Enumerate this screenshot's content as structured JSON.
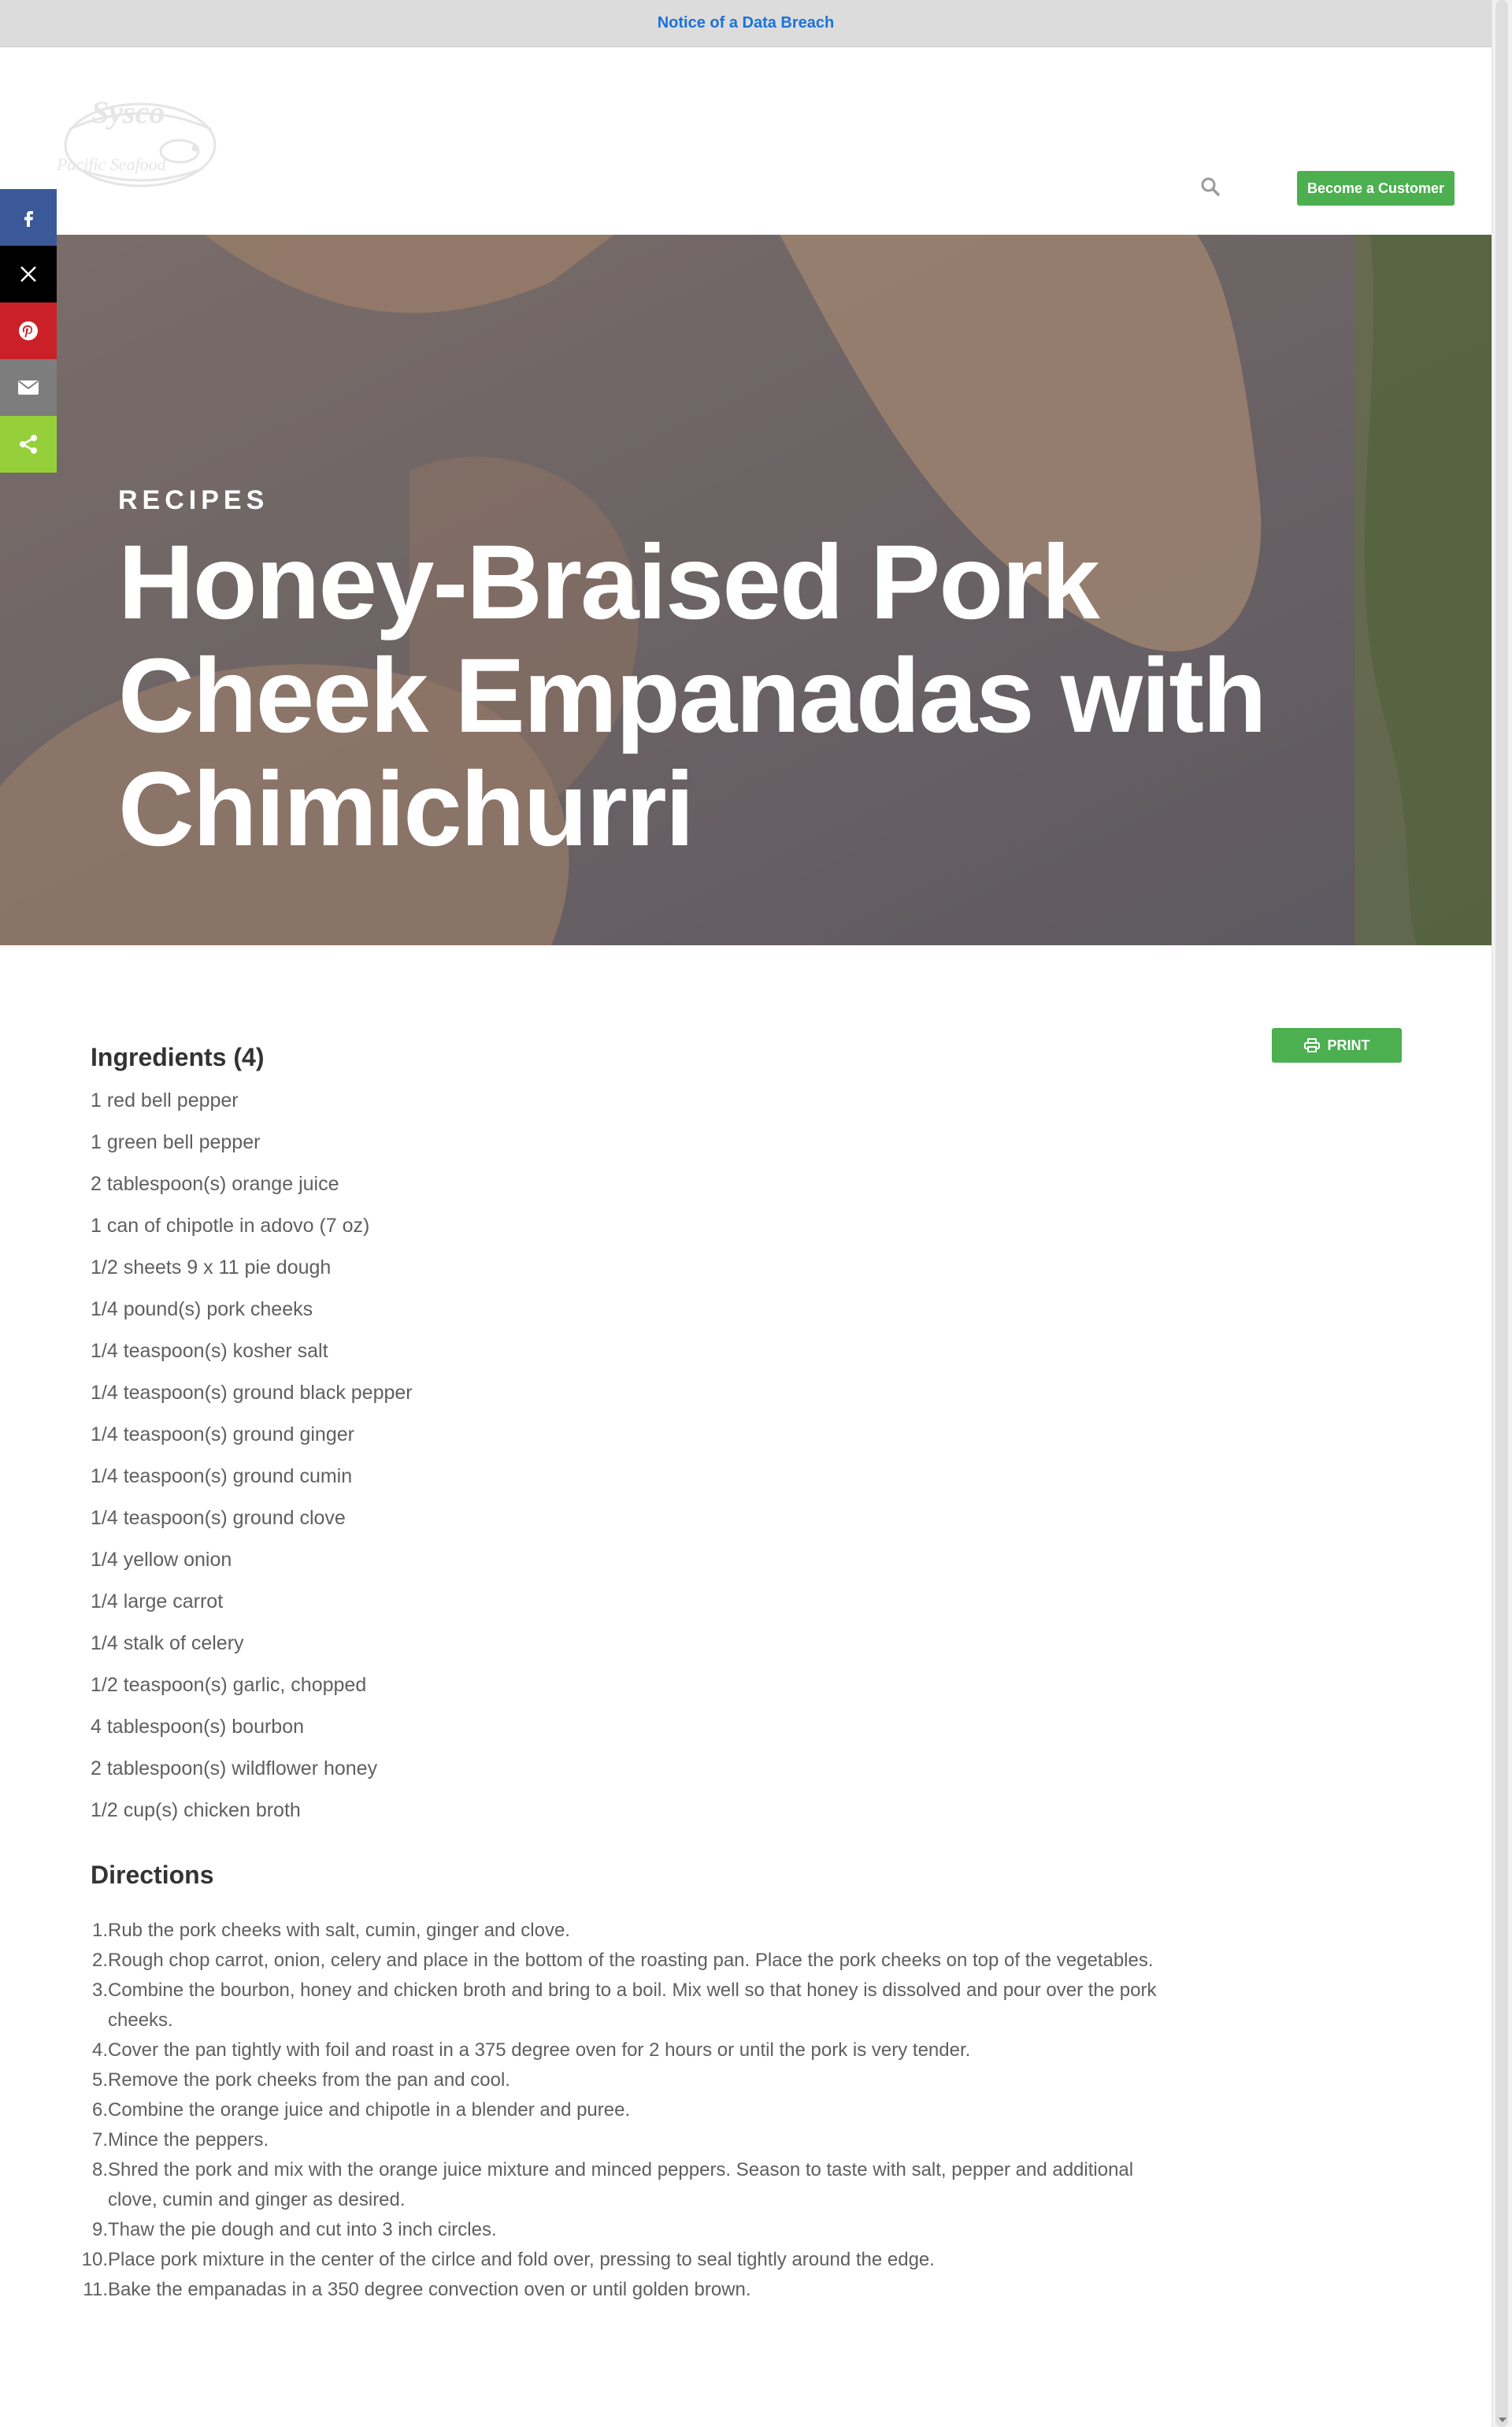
{
  "notice": {
    "link_text": "Notice of a Data Breach"
  },
  "header": {
    "logo_text_top": "Sysco",
    "logo_text_bottom": "Pacific Seafood",
    "search_icon": "search-icon",
    "customer_button": "Become a Customer",
    "accent_color": "#4caf50"
  },
  "share": [
    {
      "name": "facebook",
      "icon": "facebook-icon",
      "color": "#3b5998"
    },
    {
      "name": "x",
      "icon": "x-icon",
      "color": "#000000"
    },
    {
      "name": "pinterest",
      "icon": "pinterest-icon",
      "color": "#cb2027"
    },
    {
      "name": "email",
      "icon": "email-icon",
      "color": "#7d7d7d"
    },
    {
      "name": "share",
      "icon": "share-icon",
      "color": "#95d03a"
    }
  ],
  "hero": {
    "eyebrow": "RECIPES",
    "title": "Honey-Braised Pork Cheek Empanadas with Chimichurri"
  },
  "ingredients": {
    "heading": "Ingredients (4)",
    "print_label": "PRINT",
    "items": [
      "1 red bell pepper",
      "1 green bell pepper",
      "2 tablespoon(s) orange juice",
      "1 can of chipotle in adovo (7 oz)",
      "1/2 sheets 9 x 11 pie dough",
      "1/4 pound(s) pork cheeks",
      "1/4 teaspoon(s) kosher salt",
      "1/4 teaspoon(s) ground black pepper",
      "1/4 teaspoon(s) ground ginger",
      "1/4 teaspoon(s) ground cumin",
      "1/4 teaspoon(s) ground clove",
      "1/4 yellow onion",
      "1/4 large carrot",
      "1/4 stalk of celery",
      "1/2 teaspoon(s) garlic, chopped",
      "4 tablespoon(s) bourbon",
      "2 tablespoon(s) wildflower honey",
      "1/2 cup(s) chicken broth"
    ]
  },
  "directions": {
    "heading": "Directions",
    "steps": [
      "Rub the pork cheeks with salt, cumin, ginger and clove.",
      "Rough chop carrot, onion, celery and place in the bottom of the roasting pan. Place the pork cheeks on top of the vegetables.",
      "Combine the bourbon, honey and chicken broth and bring to a boil. Mix well so that honey is dissolved and pour over the pork cheeks.",
      "Cover the pan tightly with foil and roast in a 375 degree oven for 2 hours or until the pork is very tender.",
      "Remove the pork cheeks from the pan and cool.",
      "Combine the orange juice and chipotle in a blender and puree.",
      "Mince the peppers.",
      "Shred the pork and mix with the orange juice mixture and minced peppers. Season to taste with salt, pepper and additional clove, cumin and ginger as desired.",
      "Thaw the pie dough and cut into 3 inch circles.",
      "Place pork mixture in the center of the cirlce and fold over, pressing to seal tightly around the edge.",
      "Bake the empanadas in a 350 degree convection oven or until golden brown."
    ]
  }
}
